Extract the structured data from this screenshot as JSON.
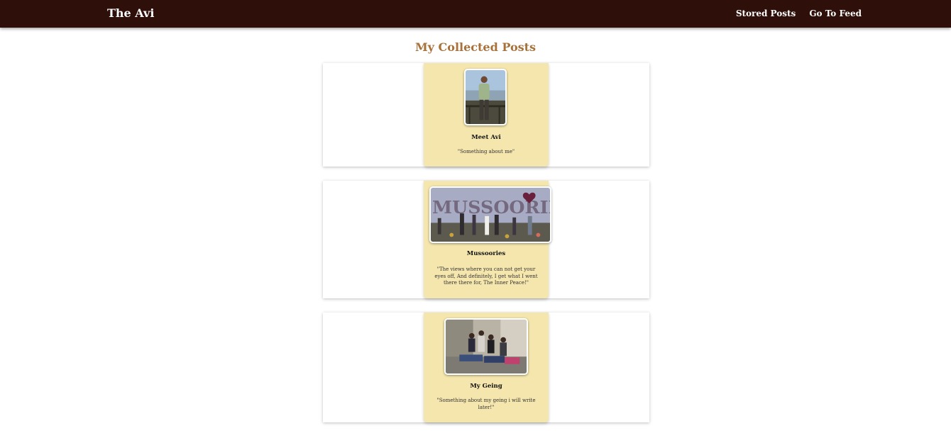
{
  "navbar": {
    "brand": "The Avi",
    "links": [
      "Stored Posts",
      "Go To Feed"
    ]
  },
  "page": {
    "title": "My Collected Posts"
  },
  "posts": [
    {
      "title": "Meet Avi",
      "description": "\"Something about me\"",
      "image_alt": "portrait photo of a person standing by a railing"
    },
    {
      "title": "Mussoories",
      "description": "\"The views where you can not get your eyes off, And definitely, I get what I went there there for, The Inner Peace!\"",
      "image_alt": "group photo in front of MUSSOORIE sign",
      "image_sign_text": "MUSSOORIE"
    },
    {
      "title": "My Geing",
      "description": "\"Something about my geing i will write later!\"",
      "image_alt": "group of friends sitting on rocks"
    }
  ],
  "colors": {
    "navbar_bg": "#2e0f09",
    "title": "#a8713a",
    "card_accent": "#f4e6ad"
  }
}
